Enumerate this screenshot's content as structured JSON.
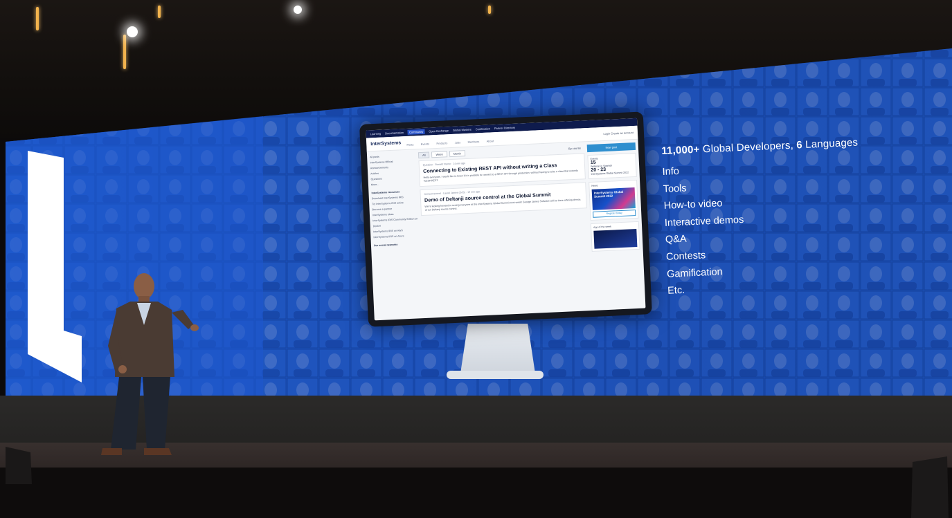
{
  "colors": {
    "wall_blue": "#1a55c4",
    "wall_dark_blue": "#0d2a7a",
    "ui_nav": "#0e1b4d",
    "ui_accent": "#2f8fcf"
  },
  "monitor": {
    "topnav": [
      "Learning",
      "Documentation",
      "Community",
      "Open Exchange",
      "Global Masters",
      "Certification",
      "Partner Directory"
    ],
    "logo": "InterSystems",
    "nav": [
      "Posts",
      "Events",
      "Products",
      "Jobs",
      "Members",
      "About"
    ],
    "header_right": "Login   Create an account",
    "tabs": [
      "All",
      "Week",
      "Month"
    ],
    "by_course": "By course",
    "sidebar": {
      "items": [
        "All posts",
        "InterSystems Official",
        "Announcements",
        "Articles",
        "Questions",
        "More..."
      ],
      "resources_title": "InterSystems resources",
      "resources": [
        "Download InterSystems IRIS",
        "Try InterSystems IRIS online",
        "Become a partner",
        "InterSystems ideas",
        "InterSystems IRIS Community Edition on Docker",
        "InterSystems IRIS on AWS",
        "InterSystems IRIS on Azure"
      ],
      "social_title": "Our social networks"
    },
    "posts": [
      {
        "type": "Question",
        "author": "Ronald Frame",
        "time": "14 min ago",
        "title": "Connecting to Existing REST API without writing a Class",
        "body": "Hello everyone, I would like to know if it is possible to connect to a REST API through production, without having to write a class that extends %CSP.REST."
      },
      {
        "type": "Announcement",
        "author": "Laurel James (GJS)",
        "time": "19 min ago",
        "title": "Demo of Deltanji source control at the Global Summit",
        "body": "We're looking forward to seeing everyone at the InterSystems Global Summit next week! George James Software will be there offering demos of our Deltanji source control."
      }
    ],
    "new_post": "New post",
    "events": {
      "title": "Events",
      "day1": "15",
      "day1_text": "Webinar in Spanish",
      "day2": "20 - 23",
      "day2_text": "InterSystems Global Summit 2022"
    },
    "news": {
      "title": "News",
      "summit": "InterSystems Global Summit 2022",
      "register": "Register today"
    },
    "app_of_week": "App of the week"
  },
  "features": {
    "headline_count": "11,000+",
    "headline_mid": " Global Developers, ",
    "headline_lang": "6",
    "headline_end": " Languages",
    "items": [
      "Info",
      "Tools",
      "How-to video",
      "Interactive demos",
      "Q&A",
      "Contests",
      "Gamification",
      "Etc."
    ]
  }
}
